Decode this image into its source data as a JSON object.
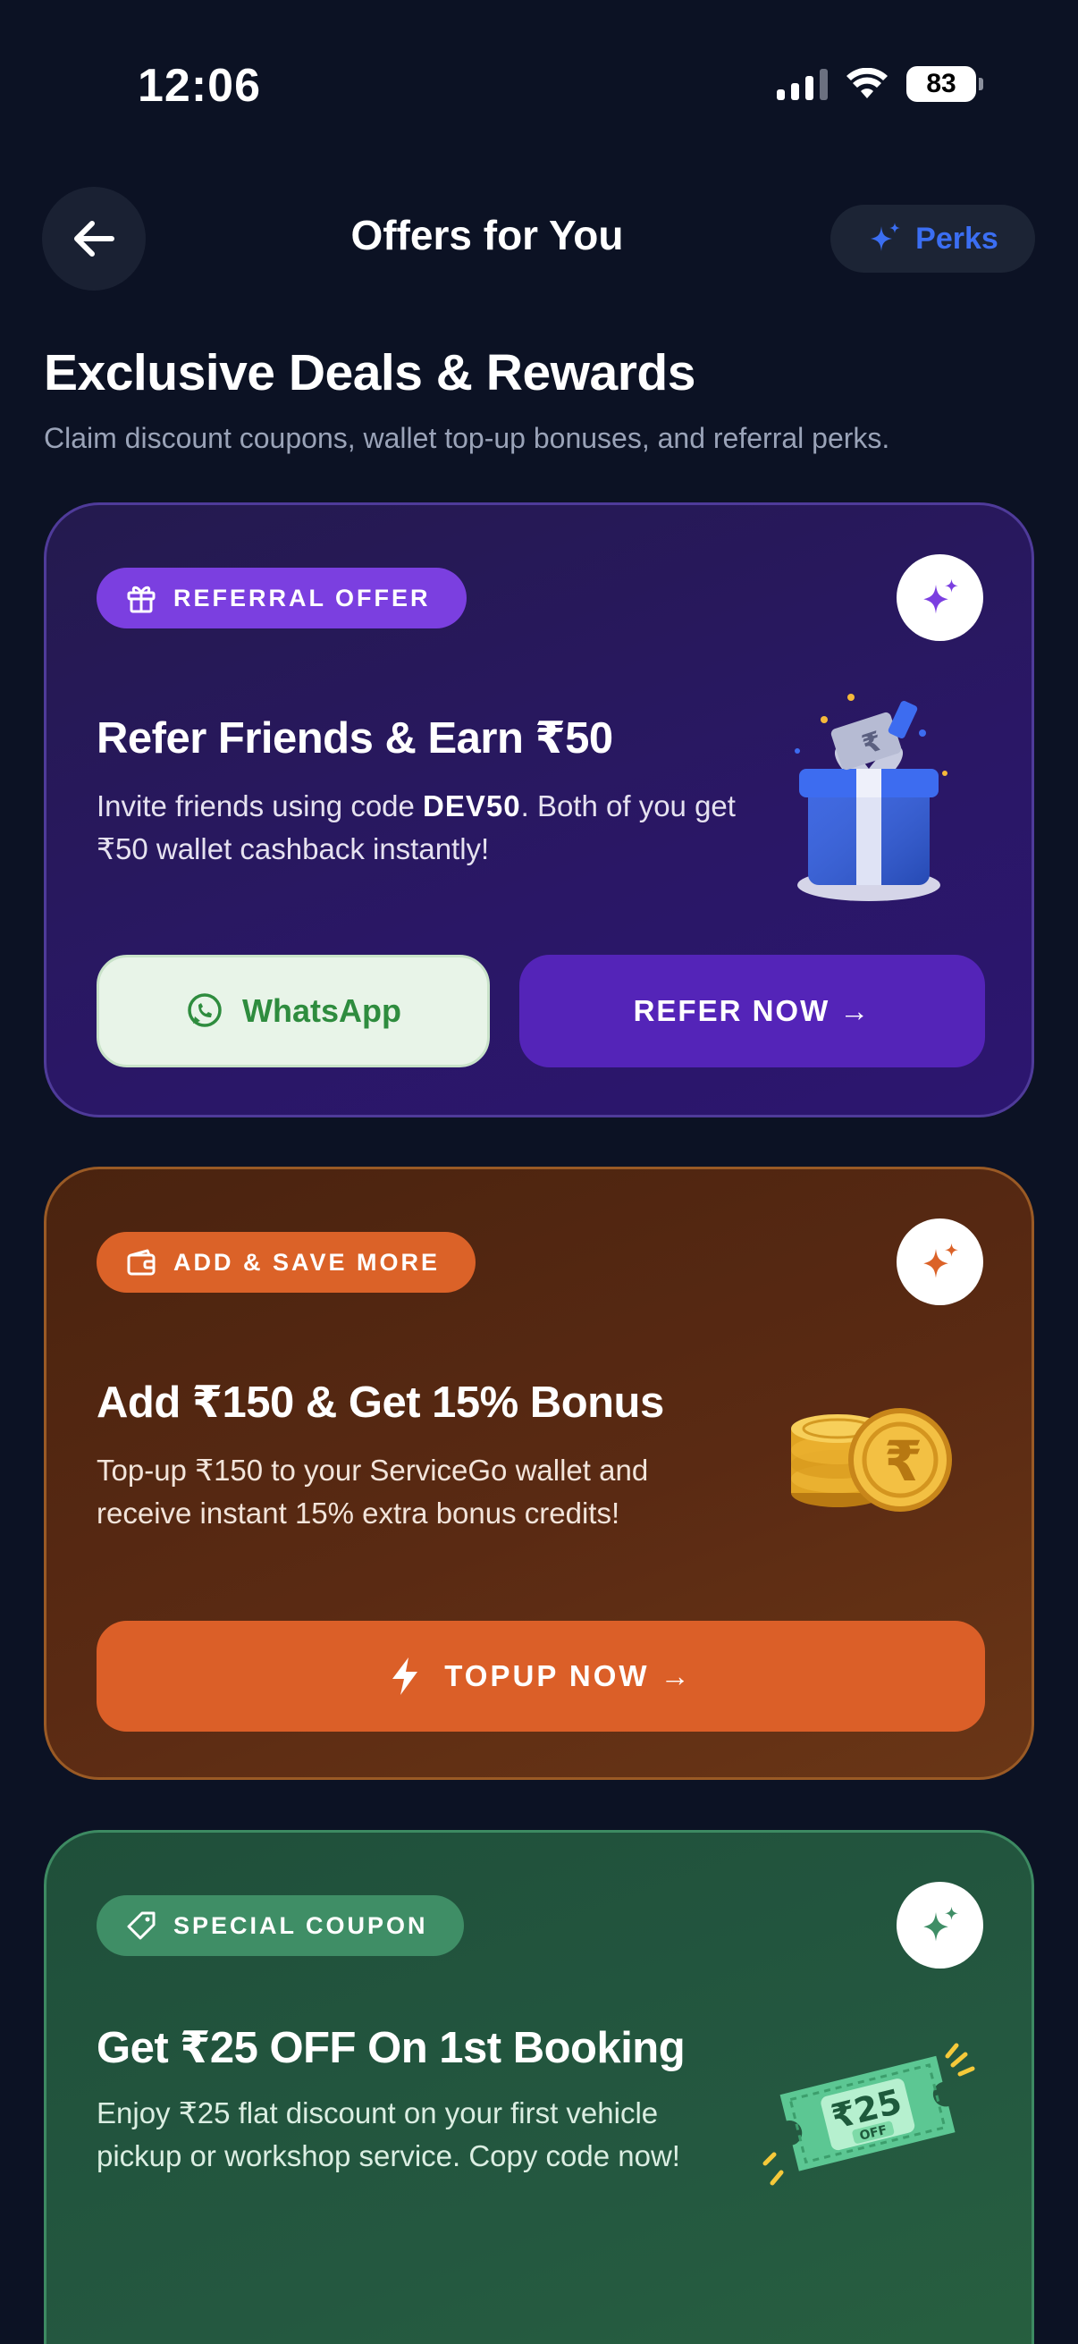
{
  "status_bar": {
    "time": "12:06",
    "battery": "83"
  },
  "nav": {
    "title": "Offers for You",
    "perks_label": "Perks"
  },
  "header": {
    "headline": "Exclusive Deals & Rewards",
    "subheadline": "Claim discount coupons, wallet top-up bonuses, and referral perks."
  },
  "cards": {
    "referral": {
      "tag": "REFERRAL OFFER",
      "title": "Refer Friends & Earn ₹50",
      "desc_before": "Invite friends using code ",
      "code": "DEV50",
      "desc_after": ". Both of you get ₹50 wallet cashback instantly!",
      "whatsapp_label": "WhatsApp",
      "refer_label": "REFER NOW →"
    },
    "topup": {
      "tag": "ADD & SAVE MORE",
      "title": "Add ₹150 & Get 15% Bonus",
      "desc": "Top-up ₹150 to your ServiceGo wallet and receive instant 15% extra bonus credits!",
      "button_label": "TOPUP NOW →"
    },
    "coupon": {
      "tag": "SPECIAL COUPON",
      "title": "Get ₹25 OFF On 1st Booking",
      "desc": "Enjoy ₹25 flat discount on your first vehicle pickup or workshop service. Copy code now!",
      "ticket_amount": "₹25",
      "ticket_off": "OFF"
    }
  },
  "colors": {
    "background": "#0c1224",
    "perks_accent": "#3b6ef2",
    "referral_tag": "#7b3fe0",
    "refer_button": "#5424b8",
    "topup_accent": "#db5f28",
    "coupon_tag": "#3f8e66",
    "whatsapp_green": "#2e8c3e"
  },
  "icons": {
    "back": "arrow-left-icon",
    "perks": "sparkles-icon",
    "referral_tag": "gift-icon",
    "topup_tag": "wallet-icon",
    "coupon_tag": "tag-icon",
    "whatsapp": "whatsapp-icon",
    "topup_button": "lightning-bolt-icon"
  }
}
